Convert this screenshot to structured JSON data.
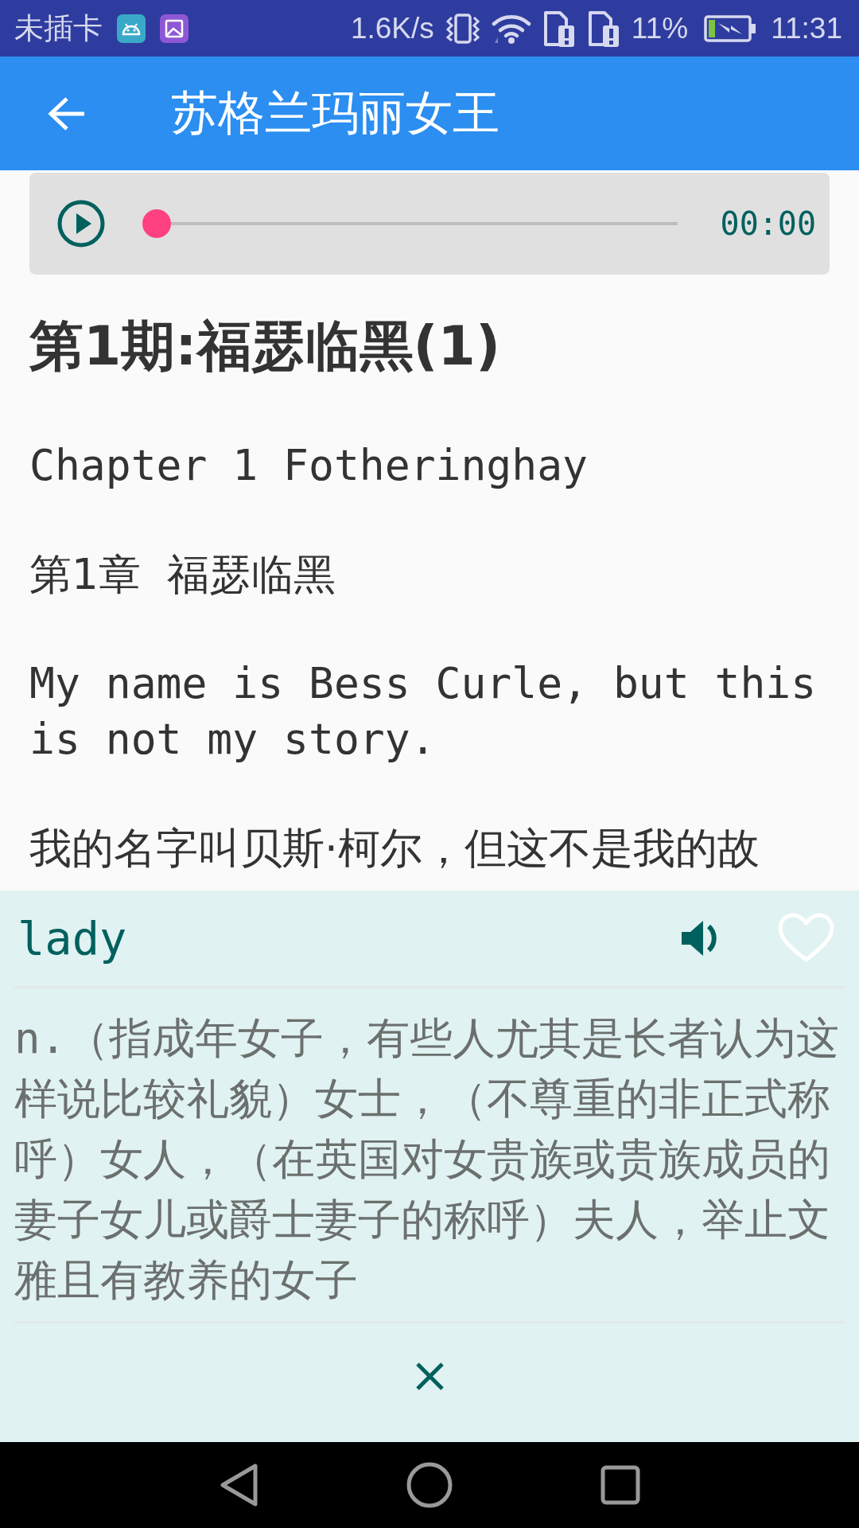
{
  "status_bar": {
    "carrier": "未插卡",
    "network_speed": "1.6K/s",
    "battery": "11%",
    "time": "11:31"
  },
  "app_bar": {
    "title": "苏格兰玛丽女王"
  },
  "audio_player": {
    "playing": false,
    "level": 0,
    "time": "00:00"
  },
  "article": {
    "title": "第1期:福瑟临黑(1)",
    "paragraphs": [
      {
        "kind": "english",
        "text": "Chapter 1 Fotheringhay"
      },
      {
        "kind": "chinese",
        "text": "第1章  福瑟临黑"
      },
      {
        "kind": "english",
        "text": "My name is Bess Curle, but this is not my story."
      },
      {
        "kind": "chinese",
        "text": "我的名字叫贝斯·柯尔，但这不是我的故"
      }
    ]
  },
  "word_panel": {
    "word": "lady",
    "favorite": false,
    "definition": "n.（指成年女子，有些人尤其是长者认为这样说比较礼貌）女士，（不尊重的非正式称呼）女人，（在英国对女贵族或贵族成员的妻子女儿或爵士妻子的称呼）夫人，举止文雅且有教养的女子"
  }
}
